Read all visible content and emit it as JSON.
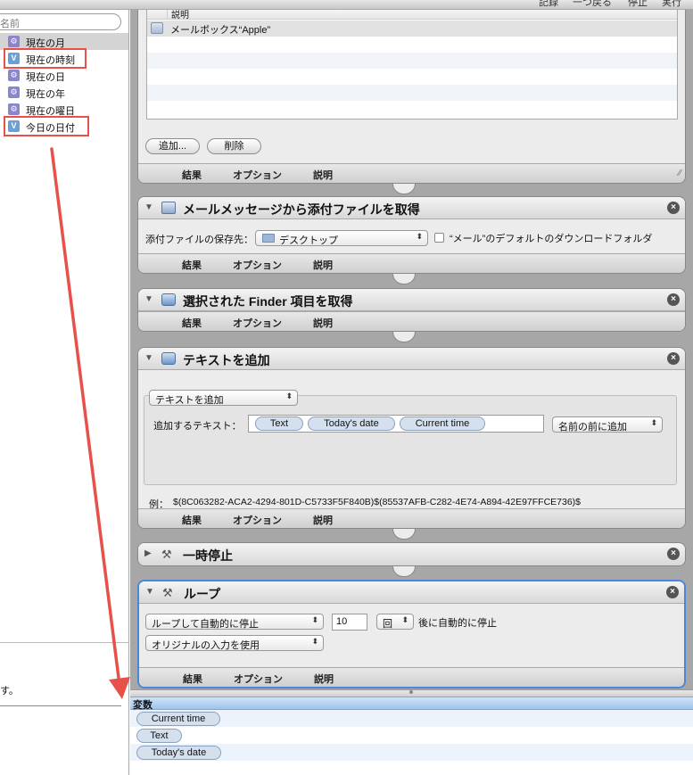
{
  "toolbar": {
    "items": [
      "記録",
      "一つ戻る",
      "停止",
      "実行"
    ]
  },
  "library": {
    "search_placeholder": "名前",
    "items": [
      {
        "label": "現在の月",
        "icon": "gear-icon"
      },
      {
        "label": "現在の時刻",
        "icon": "variable-icon"
      },
      {
        "label": "現在の日",
        "icon": "gear-icon"
      },
      {
        "label": "現在の年",
        "icon": "gear-icon"
      },
      {
        "label": "現在の曜日",
        "icon": "gear-icon"
      },
      {
        "label": "今日の日付",
        "icon": "variable-icon"
      }
    ],
    "description_fragment": "す。"
  },
  "footer_tabs": {
    "results": "結果",
    "options": "オプション",
    "description": "説明"
  },
  "panel_mailbox": {
    "column_header": "説明",
    "rows": [
      "メールボックス“Apple”"
    ],
    "add_button": "追加...",
    "delete_button": "削除"
  },
  "panel_attach": {
    "title": "メールメッセージから添付ファイルを取得",
    "save_label": "添付ファイルの保存先：",
    "save_value": "デスクトップ",
    "checkbox_label": "“メール”のデフォルトのダウンロードフォルダ"
  },
  "panel_finder": {
    "title": "選択された Finder 項目を取得"
  },
  "panel_text": {
    "title": "テキストを追加",
    "mode_select": "テキストを追加",
    "field_label": "追加するテキスト：",
    "tokens": [
      "Text",
      "Today's date",
      "Current time"
    ],
    "position_select": "名前の前に追加",
    "example_label": "例：",
    "example_value": "$(8C063282-ACA2-4294-801D-C5733F5F840B)$(85537AFB-C282-4E74-A894-42E97FFCE736)$"
  },
  "panel_pause": {
    "title": "一時停止"
  },
  "panel_loop": {
    "title": "ループ",
    "mode_select": "ループして自動的に停止",
    "count_value": "10",
    "unit_select": "回",
    "after_label": "後に自動的に停止",
    "input_select": "オリジナルの入力を使用"
  },
  "variables": {
    "header": "変数",
    "items": [
      "Current time",
      "Text",
      "Today's date"
    ]
  }
}
